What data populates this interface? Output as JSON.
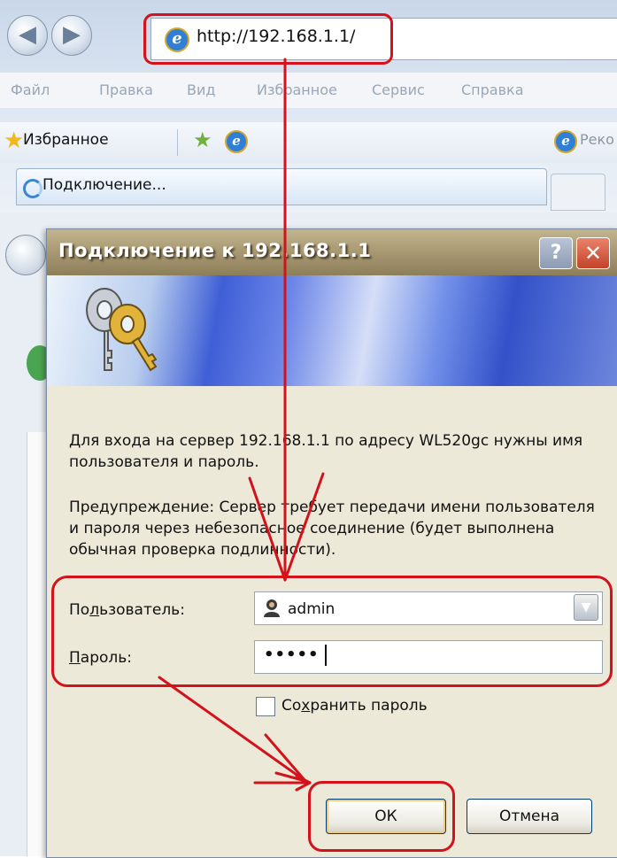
{
  "browser": {
    "address_url": "http://192.168.1.1/",
    "menu": [
      "Файл",
      "Правка",
      "Вид",
      "Избранное",
      "Сервис",
      "Справка"
    ],
    "favorites_label": "Избранное",
    "recommended_label": "Реко",
    "tab_label": "Подключение...",
    "ie_glyph": "e"
  },
  "dialog": {
    "title": "Подключение к 192.168.1.1",
    "help_glyph": "?",
    "close_glyph": "✕",
    "message": "Для входа на сервер 192.168.1.1 по адресу WL520gc нужны имя пользователя и пароль.",
    "warning": "Предупреждение: Сервер требует передачи имени пользователя и пароля через небезопасное соединение (будет выполнена обычная проверка подлинности).",
    "user_label_pre": "По",
    "user_label_ul": "л",
    "user_label_post": "ьзователь:",
    "user_value": "admin",
    "pass_label_ul": "П",
    "pass_label_post": "ароль:",
    "pass_value": "•••••",
    "remember_pre": "Со",
    "remember_ul": "х",
    "remember_post": "ранить пароль",
    "ok_label": "ОК",
    "cancel_label": "Отмена"
  },
  "colors": {
    "annotation_red": "#d3121c",
    "titlebar": "#a89872",
    "dialog_bg": "#ece9d8"
  },
  "icons": [
    "back-icon",
    "forward-icon",
    "ie-page-icon",
    "star-icon",
    "add-favorite-icon",
    "loading-spinner-icon",
    "keys-icon",
    "user-icon",
    "dropdown-arrow-icon",
    "help-icon",
    "close-icon"
  ]
}
